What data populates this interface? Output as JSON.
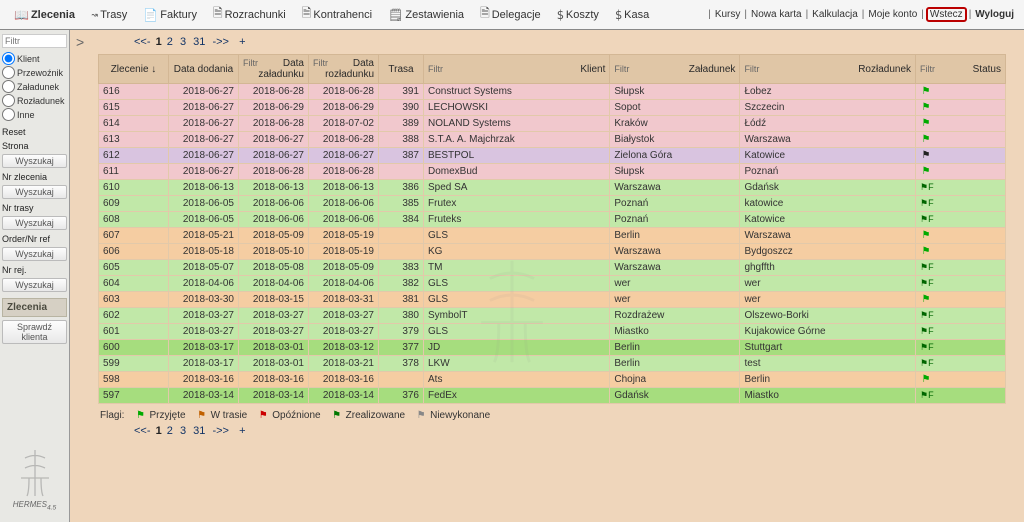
{
  "topNav": {
    "zlecenia": "Zlecenia",
    "trasy": "Trasy",
    "faktury": "Faktury",
    "rozrachunki": "Rozrachunki",
    "kontrahenci": "Kontrahenci",
    "zestawienia": "Zestawienia",
    "delegacje": "Delegacje",
    "koszty": "Koszty",
    "kasa": "Kasa"
  },
  "topLinks": {
    "kursy": "Kursy",
    "nowaKarta": "Nowa karta",
    "kalkulacja": "Kalkulacja",
    "mojeKonto": "Moje konto",
    "wstecz": "Wstecz",
    "wyloguj": "Wyloguj"
  },
  "sidebar": {
    "filtrPh": "Filtr",
    "radios": {
      "klient": "Klient",
      "przewoznik": "Przewoźnik",
      "zaladunek": "Załadunek",
      "rozladunek": "Rozładunek",
      "inne": "Inne"
    },
    "reset": "Reset",
    "strona": "Strona",
    "nrZlecenia": "Nr zlecenia",
    "nrTrasy": "Nr trasy",
    "orderNr": "Order/Nr ref",
    "nrRej": "Nr rej.",
    "wyszukaj": "Wyszukaj",
    "zleceniaHdr": "Zlecenia",
    "sprawdz": "Sprawdź klienta",
    "brand": "HERMES"
  },
  "pager": {
    "prefix": "<<-",
    "p1": "1",
    "p2": "2",
    "p3": "3",
    "p31": "31",
    "suffix": "->>",
    "plus": "+"
  },
  "columns": {
    "filtr": "Filtr",
    "zlecenie": "Zlecenie ↓",
    "dataDodania": "Data dodania",
    "dataZaladunku": "Data załadunku",
    "dataRozladunku": "Data rozładunku",
    "trasa": "Trasa",
    "klient": "Klient",
    "zaladunek": "Załadunek",
    "rozladunek": "Rozładunek",
    "status": "Status"
  },
  "rows": [
    {
      "id": "616",
      "dd": "2018-06-27",
      "dz": "2018-06-28",
      "dr": "2018-06-28",
      "tr": "391",
      "kl": "Construct Systems",
      "za": "Słupsk",
      "ro": "Łobez",
      "fl": "p",
      "cls": "r-pink"
    },
    {
      "id": "615",
      "dd": "2018-06-27",
      "dz": "2018-06-29",
      "dr": "2018-06-29",
      "tr": "390",
      "kl": "LECHOWSKI",
      "za": "Sopot",
      "ro": "Szczecin",
      "fl": "p",
      "cls": "r-pink"
    },
    {
      "id": "614",
      "dd": "2018-06-27",
      "dz": "2018-06-28",
      "dr": "2018-07-02",
      "tr": "389",
      "kl": "NOLAND Systems",
      "za": "Kraków",
      "ro": "Łódź",
      "fl": "p",
      "cls": "r-pink"
    },
    {
      "id": "613",
      "dd": "2018-06-27",
      "dz": "2018-06-27",
      "dr": "2018-06-28",
      "tr": "388",
      "kl": "S.T.A. A. Majchrzak",
      "za": "Białystok",
      "ro": "Warszawa",
      "fl": "p",
      "cls": "r-pink"
    },
    {
      "id": "612",
      "dd": "2018-06-27",
      "dz": "2018-06-27",
      "dr": "2018-06-27",
      "tr": "387",
      "kl": "BESTPOL",
      "za": "Zielona Góra",
      "ro": "Katowice",
      "fl": "k",
      "cls": "r-lilac"
    },
    {
      "id": "611",
      "dd": "2018-06-27",
      "dz": "2018-06-28",
      "dr": "2018-06-28",
      "tr": "",
      "kl": "DomexBud",
      "za": "Słupsk",
      "ro": "Poznań",
      "fl": "p",
      "cls": "r-pink"
    },
    {
      "id": "610",
      "dd": "2018-06-13",
      "dz": "2018-06-13",
      "dr": "2018-06-13",
      "tr": "386",
      "kl": "Sped SA",
      "za": "Warszawa",
      "ro": "Gdańsk",
      "fl": "pf",
      "cls": "r-green"
    },
    {
      "id": "609",
      "dd": "2018-06-05",
      "dz": "2018-06-06",
      "dr": "2018-06-06",
      "tr": "385",
      "kl": "Frutex",
      "za": "Poznań",
      "ro": "katowice",
      "fl": "pf",
      "cls": "r-green"
    },
    {
      "id": "608",
      "dd": "2018-06-05",
      "dz": "2018-06-06",
      "dr": "2018-06-06",
      "tr": "384",
      "kl": "Fruteks",
      "za": "Poznań",
      "ro": "Katowice",
      "fl": "pf",
      "cls": "r-green"
    },
    {
      "id": "607",
      "dd": "2018-05-21",
      "dz": "2018-05-09",
      "dr": "2018-05-19",
      "tr": "",
      "kl": "GLS",
      "za": "Berlin",
      "ro": "Warszawa",
      "fl": "p",
      "cls": "r-orange"
    },
    {
      "id": "606",
      "dd": "2018-05-18",
      "dz": "2018-05-10",
      "dr": "2018-05-19",
      "tr": "",
      "kl": "KG",
      "za": "Warszawa",
      "ro": "Bydgoszcz",
      "fl": "p",
      "cls": "r-orange"
    },
    {
      "id": "605",
      "dd": "2018-05-07",
      "dz": "2018-05-08",
      "dr": "2018-05-09",
      "tr": "383",
      "kl": "TM",
      "za": "Warszawa",
      "ro": "ghgffth",
      "fl": "pf",
      "cls": "r-green"
    },
    {
      "id": "604",
      "dd": "2018-04-06",
      "dz": "2018-04-06",
      "dr": "2018-04-06",
      "tr": "382",
      "kl": "GLS",
      "za": "wer",
      "ro": "wer",
      "fl": "pf",
      "cls": "r-green"
    },
    {
      "id": "603",
      "dd": "2018-03-30",
      "dz": "2018-03-15",
      "dr": "2018-03-31",
      "tr": "381",
      "kl": "GLS",
      "za": "wer",
      "ro": "wer",
      "fl": "p",
      "cls": "r-orange"
    },
    {
      "id": "602",
      "dd": "2018-03-27",
      "dz": "2018-03-27",
      "dr": "2018-03-27",
      "tr": "380",
      "kl": "SymbolT",
      "za": "Rozdrażew",
      "ro": "Olszewo-Borki",
      "fl": "pf",
      "cls": "r-green"
    },
    {
      "id": "601",
      "dd": "2018-03-27",
      "dz": "2018-03-27",
      "dr": "2018-03-27",
      "tr": "379",
      "kl": "GLS",
      "za": "Miastko",
      "ro": "Kujakowice Górne",
      "fl": "pf",
      "cls": "r-green"
    },
    {
      "id": "600",
      "dd": "2018-03-17",
      "dz": "2018-03-01",
      "dr": "2018-03-12",
      "tr": "377",
      "kl": "JD",
      "za": "Berlin",
      "ro": "Stuttgart",
      "fl": "pf",
      "cls": "r-medgreen"
    },
    {
      "id": "599",
      "dd": "2018-03-17",
      "dz": "2018-03-01",
      "dr": "2018-03-21",
      "tr": "378",
      "kl": "LKW",
      "za": "Berlin",
      "ro": "test",
      "fl": "pf",
      "cls": "r-green"
    },
    {
      "id": "598",
      "dd": "2018-03-16",
      "dz": "2018-03-16",
      "dr": "2018-03-16",
      "tr": "",
      "kl": "Ats",
      "za": "Chojna",
      "ro": "Berlin",
      "fl": "p",
      "cls": "r-orange"
    },
    {
      "id": "597",
      "dd": "2018-03-14",
      "dz": "2018-03-14",
      "dr": "2018-03-14",
      "tr": "376",
      "kl": "FedEx",
      "za": "Gdańsk",
      "ro": "Miastko",
      "fl": "pf",
      "cls": "r-medgreen"
    }
  ],
  "legend": {
    "label": "Flagi:",
    "przyjete": "Przyjęte",
    "wtrasie": "W trasie",
    "opoznione": "Opóźnione",
    "zrealizowane": "Zrealizowane",
    "niewykonane": "Niewykonane"
  }
}
